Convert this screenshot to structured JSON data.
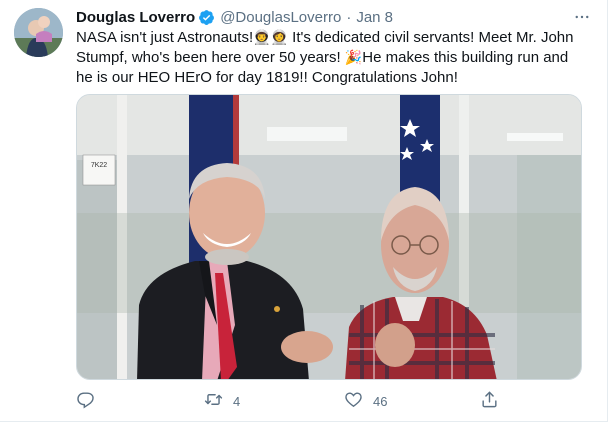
{
  "tweet": {
    "display_name": "Douglas Loverro",
    "handle": "@DouglasLoverro",
    "separator": "·",
    "date": "Jan 8",
    "text_part1": "NASA isn't just Astronauts!",
    "emoji1": "👨‍🚀👩‍🚀",
    "text_part2": " It's dedicated civil servants! Meet Mr. John Stumpf, who's been here over 50 years! ",
    "emoji2": "🎉",
    "text_part3": "He makes this building run and he is our HEO HErO for day 1819!! Congratulations John!",
    "photo_sign": "7K22",
    "actions": {
      "retweet_count": "4",
      "like_count": "46"
    }
  },
  "colors": {
    "verified": "#1da1f2",
    "muted": "#5b7083",
    "text": "#0f1419"
  }
}
